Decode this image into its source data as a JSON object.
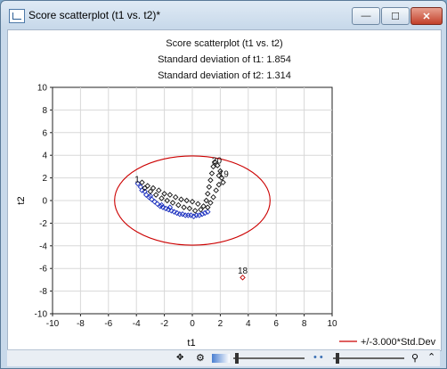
{
  "window": {
    "title": "Score scatterplot (t1 vs. t2)*"
  },
  "title_buttons": {
    "minimize": "—",
    "maximize": "☐",
    "close": "✕"
  },
  "chart_header": {
    "title": "Score scatterplot (t1 vs. t2)",
    "stat1": "Standard deviation of t1: 1.854",
    "stat2": "Standard deviation of t2: 1.314"
  },
  "chart_data": {
    "type": "scatter",
    "xlabel": "t1",
    "ylabel": "t2",
    "xlim": [
      -10,
      10
    ],
    "ylim": [
      -10,
      10
    ],
    "xticks": [
      -10,
      -8,
      -6,
      -4,
      -2,
      0,
      2,
      4,
      6,
      8,
      10
    ],
    "yticks": [
      -10,
      -8,
      -6,
      -4,
      -2,
      0,
      2,
      4,
      6,
      8,
      10
    ],
    "grid": true,
    "ellipse": {
      "label": "+/-3.000*Std.Dev",
      "rx": 5.562,
      "ry": 3.942,
      "color": "#cc0000"
    },
    "legend": {
      "position": "bottom-right",
      "label": "+/-3.000*Std.Dev"
    },
    "series": [
      {
        "color": "#1a2fbf",
        "points": [
          [
            -3.9,
            1.5
          ],
          [
            -3.7,
            1.2
          ],
          [
            -3.6,
            0.9
          ],
          [
            -3.4,
            0.8
          ],
          [
            -3.3,
            0.5
          ],
          [
            -3.1,
            0.3
          ],
          [
            -2.9,
            0.1
          ],
          [
            -2.7,
            -0.1
          ],
          [
            -2.5,
            -0.3
          ],
          [
            -2.3,
            -0.5
          ],
          [
            -2.1,
            -0.6
          ],
          [
            -1.9,
            -0.7
          ],
          [
            -1.7,
            -0.8
          ],
          [
            -1.5,
            -0.9
          ],
          [
            -1.3,
            -1.0
          ],
          [
            -1.1,
            -1.1
          ],
          [
            -0.9,
            -1.2
          ],
          [
            -0.7,
            -1.2
          ],
          [
            -0.5,
            -1.3
          ],
          [
            -0.3,
            -1.3
          ],
          [
            -0.1,
            -1.3
          ],
          [
            0.1,
            -1.4
          ],
          [
            0.3,
            -1.3
          ],
          [
            0.5,
            -1.3
          ],
          [
            0.7,
            -1.2
          ],
          [
            0.9,
            -1.1
          ],
          [
            1.1,
            -1.0
          ],
          [
            -3.0,
            0.4
          ],
          [
            -2.2,
            -0.4
          ],
          [
            -1.6,
            -0.6
          ]
        ]
      },
      {
        "color": "#111111",
        "points": [
          [
            -3.6,
            1.6
          ],
          [
            -3.2,
            1.3
          ],
          [
            -2.8,
            1.1
          ],
          [
            -2.4,
            0.9
          ],
          [
            -2.0,
            0.6
          ],
          [
            -1.6,
            0.5
          ],
          [
            -1.2,
            0.3
          ],
          [
            -0.8,
            0.1
          ],
          [
            -0.4,
            0.0
          ],
          [
            0.0,
            -0.1
          ],
          [
            0.4,
            -0.3
          ],
          [
            0.8,
            -0.5
          ],
          [
            1.0,
            0.0
          ],
          [
            1.1,
            0.6
          ],
          [
            1.2,
            1.2
          ],
          [
            1.3,
            1.8
          ],
          [
            1.4,
            2.4
          ],
          [
            1.5,
            3.0
          ],
          [
            1.6,
            3.4
          ],
          [
            1.8,
            3.1
          ],
          [
            2.0,
            2.6
          ],
          [
            2.1,
            2.0
          ],
          [
            1.9,
            1.4
          ],
          [
            1.7,
            0.9
          ],
          [
            1.5,
            0.3
          ],
          [
            1.3,
            -0.2
          ],
          [
            1.1,
            -0.6
          ],
          [
            0.6,
            -0.8
          ],
          [
            0.2,
            -0.9
          ],
          [
            -0.2,
            -0.7
          ],
          [
            -0.6,
            -0.6
          ],
          [
            -1.0,
            -0.4
          ],
          [
            -1.4,
            -0.2
          ],
          [
            -1.8,
            0.0
          ],
          [
            -2.2,
            0.2
          ],
          [
            -2.6,
            0.5
          ],
          [
            -3.0,
            0.8
          ],
          [
            -3.4,
            1.1
          ],
          [
            1.9,
            2.2
          ],
          [
            2.2,
            1.6
          ]
        ]
      },
      {
        "color": "#c00000",
        "points": [
          [
            3.6,
            -6.8
          ]
        ]
      }
    ],
    "annotations": [
      {
        "text": "1",
        "x": -3.95,
        "y": 1.6
      },
      {
        "text": "20",
        "x": 1.75,
        "y": 3.25
      },
      {
        "text": "19",
        "x": 2.25,
        "y": 2.1
      },
      {
        "text": "18",
        "x": 3.6,
        "y": -6.45
      }
    ]
  }
}
